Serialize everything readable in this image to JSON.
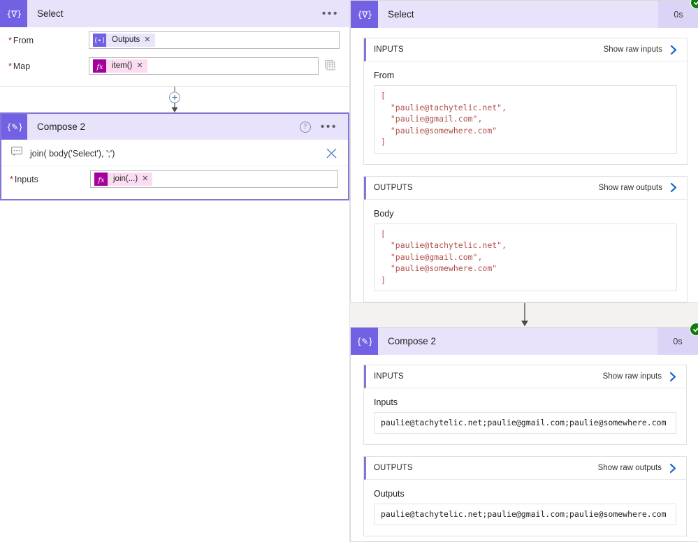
{
  "designer": {
    "select_card": {
      "icon": "select-action-icon",
      "title": "Select",
      "more_label": "•••",
      "fields": [
        {
          "label": "From",
          "required": "*",
          "chip_icon": "dynamic-content-icon",
          "chip_icon_glyph": "{x}",
          "chip_text": "Outputs",
          "chip_remove": "✕",
          "chip_kind": "dyn",
          "trailing_icon": ""
        },
        {
          "label": "Map",
          "required": "*",
          "chip_icon": "expression-function-icon",
          "chip_icon_glyph": "fx",
          "chip_text": "item()",
          "chip_remove": "✕",
          "chip_kind": "fx",
          "trailing_icon": "switch-map-view-icon"
        }
      ]
    },
    "connector": {
      "add_label": "+",
      "icon": "add-step-plus-icon"
    },
    "compose_card": {
      "icon": "compose-action-icon",
      "title": "Compose 2",
      "help_label": "?",
      "more_label": "•••",
      "comment": {
        "icon": "comment-icon",
        "text": "join( body('Select'), ';')",
        "close_label": "✕"
      },
      "fields": [
        {
          "label": "Inputs",
          "required": "*",
          "chip_icon": "expression-function-icon",
          "chip_icon_glyph": "fx",
          "chip_text": "join(...)",
          "chip_remove": "✕",
          "chip_kind": "fx"
        }
      ]
    }
  },
  "run_details": {
    "select": {
      "icon": "select-action-icon",
      "title": "Select",
      "duration": "0s",
      "status": "succeeded",
      "status_icon": "green-check-icon",
      "inputs": {
        "header": "INPUTS",
        "show_raw_label": "Show raw inputs",
        "chevron": "chevron-right-icon",
        "field_name": "From",
        "value": "[\n  \"paulie@tachytelic.net\",\n  \"paulie@gmail.com\",\n  \"paulie@somewhere.com\"\n]"
      },
      "outputs": {
        "header": "OUTPUTS",
        "show_raw_label": "Show raw outputs",
        "chevron": "chevron-right-icon",
        "field_name": "Body",
        "value": "[\n  \"paulie@tachytelic.net\",\n  \"paulie@gmail.com\",\n  \"paulie@somewhere.com\"\n]"
      }
    },
    "compose": {
      "icon": "compose-action-icon",
      "title": "Compose 2",
      "duration": "0s",
      "status": "succeeded",
      "status_icon": "green-check-icon",
      "inputs": {
        "header": "INPUTS",
        "show_raw_label": "Show raw inputs",
        "chevron": "chevron-right-icon",
        "field_name": "Inputs",
        "value": "paulie@tachytelic.net;paulie@gmail.com;paulie@somewhere.com"
      },
      "outputs": {
        "header": "OUTPUTS",
        "show_raw_label": "Show raw outputs",
        "chevron": "chevron-right-icon",
        "field_name": "Outputs",
        "value": "paulie@tachytelic.net;paulie@gmail.com;paulie@somewhere.com"
      }
    }
  },
  "colors": {
    "accent_purple": "#7262e3",
    "header_lavender": "#e8e3fb",
    "duration_lavender": "#dcd4f7",
    "chip_fx_magenta": "#a4009c",
    "chip_fx_pink": "#fbdcf2",
    "chip_dyn_lavender": "#e9e5fa",
    "link_blue": "#0f62c8",
    "success_green": "#107c10",
    "json_string_red": "#b1504a",
    "required_red": "#a4262c"
  }
}
